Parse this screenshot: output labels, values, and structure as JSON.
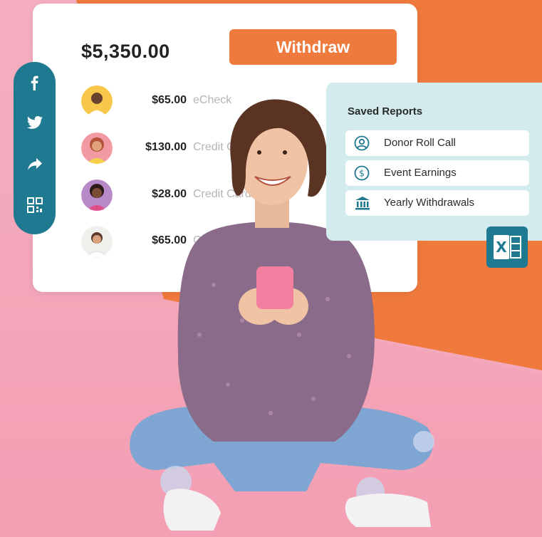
{
  "wallet": {
    "balance": "$5,350.00",
    "withdraw_label": "Withdraw",
    "transactions": [
      {
        "amount": "$65.00",
        "method": "eCheck"
      },
      {
        "amount": "$130.00",
        "method": "Credit Ca"
      },
      {
        "amount": "$28.00",
        "method": "Credit Card"
      },
      {
        "amount": "$65.00",
        "method": "C"
      }
    ]
  },
  "social": {
    "items": [
      "facebook-icon",
      "twitter-icon",
      "share-icon",
      "qr-code-icon"
    ]
  },
  "reports": {
    "title": "Saved Reports",
    "items": [
      {
        "label": "Donor Roll Call",
        "icon": "user-circle-icon"
      },
      {
        "label": "Event Earnings",
        "icon": "dollar-circle-icon"
      },
      {
        "label": "Yearly Withdrawals",
        "icon": "bank-icon"
      }
    ],
    "excel_icon": "excel-icon"
  },
  "colors": {
    "orange": "#f07a3e",
    "pink": "#f3a9bb",
    "teal": "#1f7a91",
    "report_bg": "#d4ebee"
  }
}
